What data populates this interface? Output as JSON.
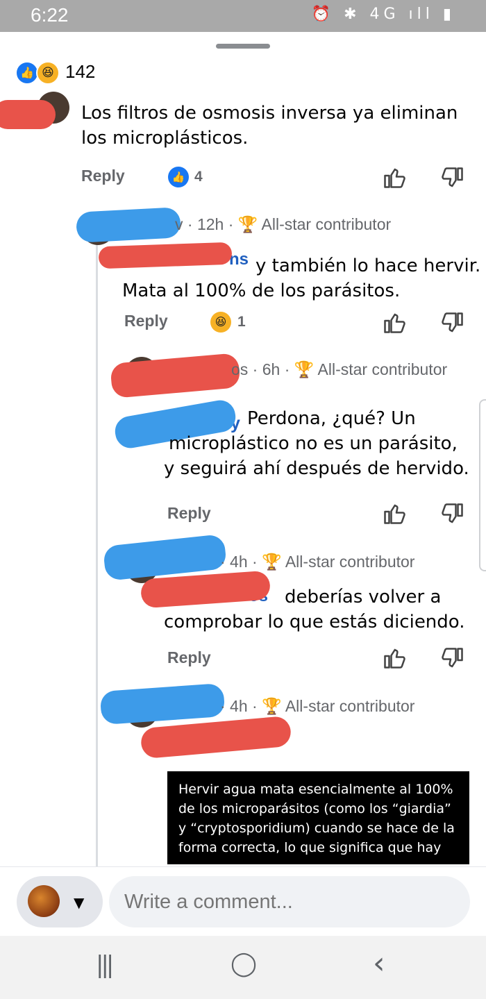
{
  "status_bar": {
    "time": "6:22",
    "icons": "⏰ ✱ 4G ıll ▮"
  },
  "reactions": {
    "count": "142",
    "icons": [
      "like-icon",
      "haha-icon"
    ]
  },
  "comments": [
    {
      "text": "Los filtros de osmosis inversa ya eliminan los microplásticos.",
      "reply_label": "Reply",
      "reaction_count": "4"
    },
    {
      "meta": "v · 12h ·",
      "badge": "All-star contributor",
      "name_fragment": "ns",
      "text_line1": "y también lo hace hervir.",
      "text_line2": "Mata al 100% de los parásitos.",
      "reply_label": "Reply",
      "reaction_count": "1"
    },
    {
      "meta": "os · 6h ·",
      "badge": "All-star contributor",
      "name_fragment": "y",
      "text_line1": "Perdona, ¿qué? Un",
      "text_line2": "microplástico no es un parásito,",
      "text_line3": "y seguirá ahí después de hervido.",
      "reply_label": "Reply"
    },
    {
      "meta": "· 4h ·",
      "badge": "All-star contributor",
      "name_fragment": "os",
      "text_line1": "deberías volver a",
      "text_line2": "comprobar lo que estás diciendo.",
      "reply_label": "Reply"
    },
    {
      "meta": "· 4h ·",
      "badge": "All-star contributor"
    }
  ],
  "overlay_text": "Hervir agua mata esencialmente al 100% de los microparásitos (como los “giardia” y “cryptosporidium) cuando se hace de la forma correcta, lo que significa que hay",
  "composer": {
    "placeholder": "Write a comment..."
  },
  "nav": {
    "recents": "|||",
    "home": "◯",
    "back": "‹"
  }
}
